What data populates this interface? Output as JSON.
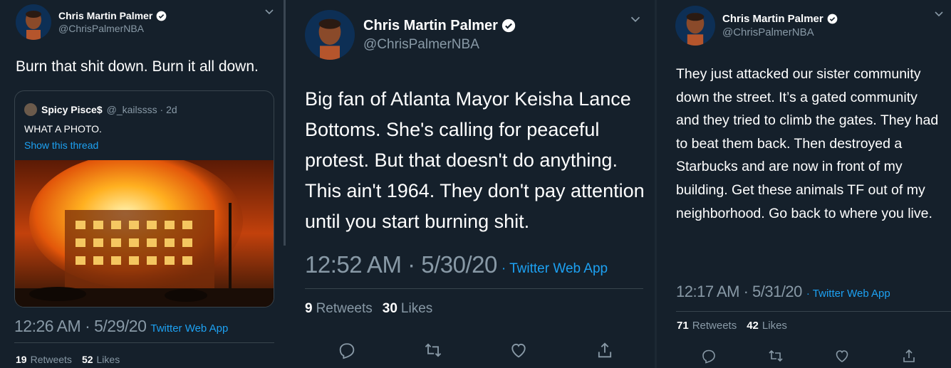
{
  "colors": {
    "background": "#15202b",
    "text": "#ffffff",
    "muted": "#8899a6",
    "accent": "#1da1f2",
    "border": "#38444d"
  },
  "tweets": [
    {
      "author": {
        "name": "Chris Martin Palmer",
        "handle": "@ChrisPalmerNBA",
        "verified": true
      },
      "text": "Burn that shit down. Burn it all down.",
      "quote": {
        "name": "Spicy Pisce$",
        "handle": "@_kailssss · 2d",
        "text": "WHAT A PHOTO.",
        "link": "Show this thread",
        "photo": "burning-building-photo"
      },
      "time": "12:26 AM · 5/29/20",
      "source": "Twitter Web App",
      "retweets": "19",
      "retweets_label": "Retweets",
      "likes": "52",
      "likes_label": "Likes"
    },
    {
      "author": {
        "name": "Chris Martin Palmer",
        "handle": "@ChrisPalmerNBA",
        "verified": true
      },
      "text": "Big fan of Atlanta Mayor Keisha Lance Bottoms. She's calling for peaceful protest. But that doesn't do anything. This ain't 1964. They don't pay attention until you start burning shit.",
      "time": "12:52 AM · 5/30/20",
      "source": "· Twitter Web App",
      "retweets": "9",
      "retweets_label": "Retweets",
      "likes": "30",
      "likes_label": "Likes",
      "actions": [
        "reply-icon",
        "retweet-icon",
        "like-icon",
        "share-icon"
      ]
    },
    {
      "author": {
        "name": "Chris Martin Palmer",
        "handle": "@ChrisPalmerNBA",
        "verified": true
      },
      "text": "They just attacked our sister community down the street. It’s a gated community and they tried to climb the gates. They had to beat them back. Then destroyed a Starbucks and are now in front of my building. Get these animals TF out of my neighborhood. Go back to where you live.",
      "time": "12:17 AM · 5/31/20",
      "source": "· Twitter Web App",
      "retweets": "71",
      "retweets_label": "Retweets",
      "likes": "42",
      "likes_label": "Likes",
      "actions": [
        "reply-icon",
        "retweet-icon",
        "like-icon",
        "share-icon"
      ]
    }
  ]
}
